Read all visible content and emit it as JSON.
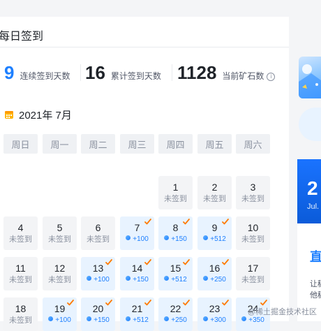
{
  "header": {
    "title": "每日签到"
  },
  "stats": [
    {
      "value": "9",
      "label": "连续签到天数",
      "accent": true
    },
    {
      "value": "16",
      "label": "累计签到天数",
      "accent": false
    },
    {
      "value": "1128",
      "label": "当前矿石数",
      "accent": false,
      "info": true
    }
  ],
  "calendar": {
    "month_label": "2021年 7月",
    "weekdays": [
      "周日",
      "周一",
      "周二",
      "周三",
      "周四",
      "周五",
      "周六"
    ],
    "unsigned_text": "未签到",
    "days": [
      {
        "day": "1",
        "status": "未签到",
        "signed": false
      },
      {
        "day": "2",
        "status": "未签到",
        "signed": false
      },
      {
        "day": "3",
        "status": "未签到",
        "signed": false
      },
      {
        "day": "4",
        "status": "未签到",
        "signed": false
      },
      {
        "day": "5",
        "status": "未签到",
        "signed": false
      },
      {
        "day": "6",
        "status": "未签到",
        "signed": false
      },
      {
        "day": "7",
        "status": "+100",
        "signed": true
      },
      {
        "day": "8",
        "status": "+150",
        "signed": true
      },
      {
        "day": "9",
        "status": "+512",
        "signed": true
      },
      {
        "day": "10",
        "status": "未签到",
        "signed": false
      },
      {
        "day": "11",
        "status": "未签到",
        "signed": false
      },
      {
        "day": "12",
        "status": "未签到",
        "signed": false
      },
      {
        "day": "13",
        "status": "+100",
        "signed": true
      },
      {
        "day": "14",
        "status": "+150",
        "signed": true
      },
      {
        "day": "15",
        "status": "+512",
        "signed": true
      },
      {
        "day": "16",
        "status": "+250",
        "signed": true
      },
      {
        "day": "17",
        "status": "未签到",
        "signed": false
      },
      {
        "day": "18",
        "status": "未签到",
        "signed": false
      },
      {
        "day": "19",
        "status": "+100",
        "signed": true
      },
      {
        "day": "20",
        "status": "+150",
        "signed": true
      },
      {
        "day": "21",
        "status": "+512",
        "signed": true
      },
      {
        "day": "22",
        "status": "+250",
        "signed": true
      },
      {
        "day": "23",
        "status": "+300",
        "signed": true
      },
      {
        "day": "24",
        "status": "+350",
        "signed": true
      }
    ],
    "colors": {
      "accent_blue": "#1e80ff",
      "check_orange": "#ff7a00",
      "signed_cell": "#e8f3ff",
      "unsigned_cell": "#f3f4f6"
    }
  },
  "side": {
    "promo_big_text": "2",
    "promo_small_text": "Jul.",
    "promo_heading": "直",
    "promo_line1": "让稿",
    "promo_line2": "他稿"
  },
  "watermark": "@稀土掘金技术社区"
}
